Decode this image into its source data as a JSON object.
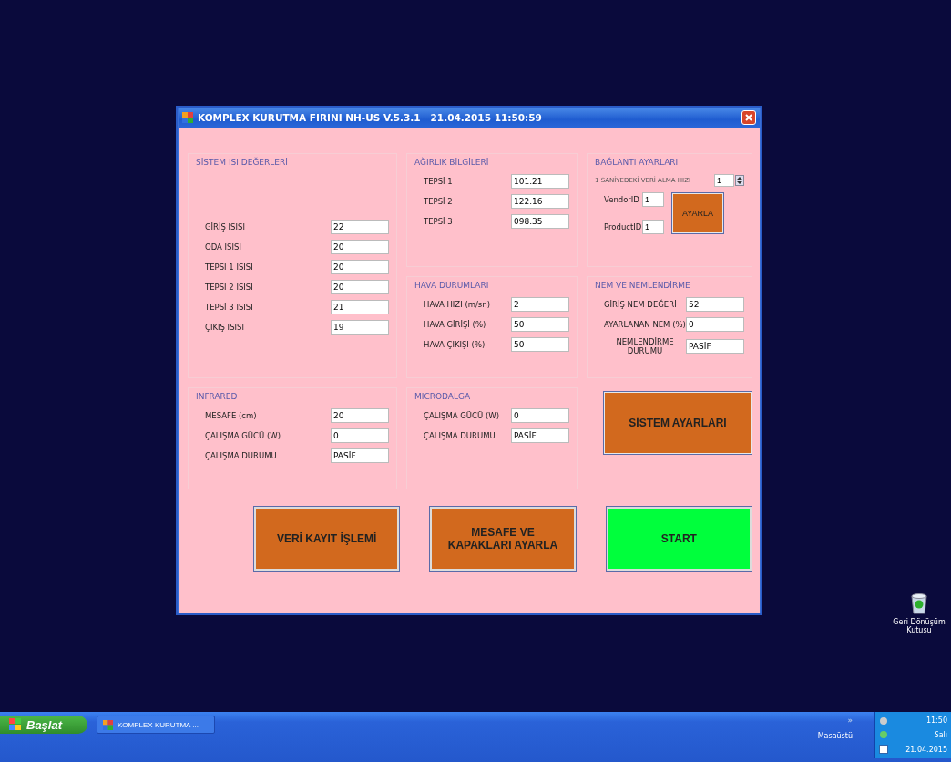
{
  "window": {
    "title": "KOMPLEX KURUTMA FIRINI NH-US V.5.3.1   21.04.2015 11:50:59"
  },
  "groups": [
    {
      "kind": "fields",
      "title": "SİSTEM ISI DEĞERLERİ",
      "fields": [
        {
          "label": "GİRİŞ ISISI",
          "value": "22"
        },
        {
          "label": "ODA ISISI",
          "value": "20"
        },
        {
          "label": "TEPSİ 1 ISISI",
          "value": "20"
        },
        {
          "label": "TEPSİ 2 ISISI",
          "value": "20"
        },
        {
          "label": "TEPSİ 3 ISISI",
          "value": "21"
        },
        {
          "label": "ÇIKIŞ ISISI",
          "value": "19"
        }
      ]
    },
    {
      "kind": "fields",
      "title": "AĞIRLIK BİLGİLERİ",
      "fields": [
        {
          "label": "TEPSİ 1",
          "value": "101.21"
        },
        {
          "label": "TEPSİ 2",
          "value": "122.16"
        },
        {
          "label": "TEPSİ 3",
          "value": "098.35"
        }
      ]
    },
    {
      "kind": "connection",
      "title": "BAĞLANTI AYARLARI",
      "rate_label": "1 SANİYEDEKİ VERİ ALMA HIZI",
      "rate_value": "1",
      "fields": [
        {
          "label": "VendorID",
          "value": "1"
        },
        {
          "label": "ProductID",
          "value": "1"
        }
      ],
      "button": "AYARLA"
    },
    {
      "kind": "fields",
      "title": "HAVA DURUMLARI",
      "fields": [
        {
          "label": "HAVA HIZI (m/sn)",
          "value": "2"
        },
        {
          "label": "HAVA GİRİŞİ (%)",
          "value": "50"
        },
        {
          "label": "HAVA ÇIKIŞI (%)",
          "value": "50"
        }
      ]
    },
    {
      "kind": "fields",
      "title": "NEM VE NEMLENDİRME",
      "fields": [
        {
          "label": "GİRİŞ NEM DEĞERİ",
          "value": "52"
        },
        {
          "label": "AYARLANAN NEM (%)",
          "value": "0"
        },
        {
          "label": "NEMLENDİRME DURUMU",
          "value": "PASİF"
        }
      ]
    },
    {
      "kind": "fields",
      "title": "INFRARED",
      "fields": [
        {
          "label": "MESAFE (cm)",
          "value": "20"
        },
        {
          "label": "ÇALIŞMA GÜCÜ (W)",
          "value": "0"
        },
        {
          "label": "ÇALIŞMA DURUMU",
          "value": "PASİF"
        }
      ]
    },
    {
      "kind": "fields",
      "title": "MICRODALGA",
      "fields": [
        {
          "label": "ÇALIŞMA GÜCÜ (W)",
          "value": "0"
        },
        {
          "label": "ÇALIŞMA DURUMU",
          "value": "PASİF"
        }
      ]
    }
  ],
  "settings_button": "SİSTEM AYARLARI",
  "buttons": [
    {
      "label": "VERİ KAYIT İŞLEMİ",
      "kind": "action"
    },
    {
      "label": "MESAFE VE KAPAKLARI AYARLA",
      "kind": "action"
    },
    {
      "label": "START",
      "kind": "start"
    }
  ],
  "desktop_icons": [
    {
      "label": "Geri Dönüşüm Kutusu"
    }
  ],
  "taskbar": {
    "start": "Başlat",
    "tasks": [
      {
        "label": "KOMPLEX KURUTMA ...",
        "selected": false
      }
    ],
    "chevron": "»",
    "desktop_label": "Masaüstü",
    "clock": {
      "time": "11:50",
      "day": "Salı",
      "date": "21.04.2015"
    }
  }
}
